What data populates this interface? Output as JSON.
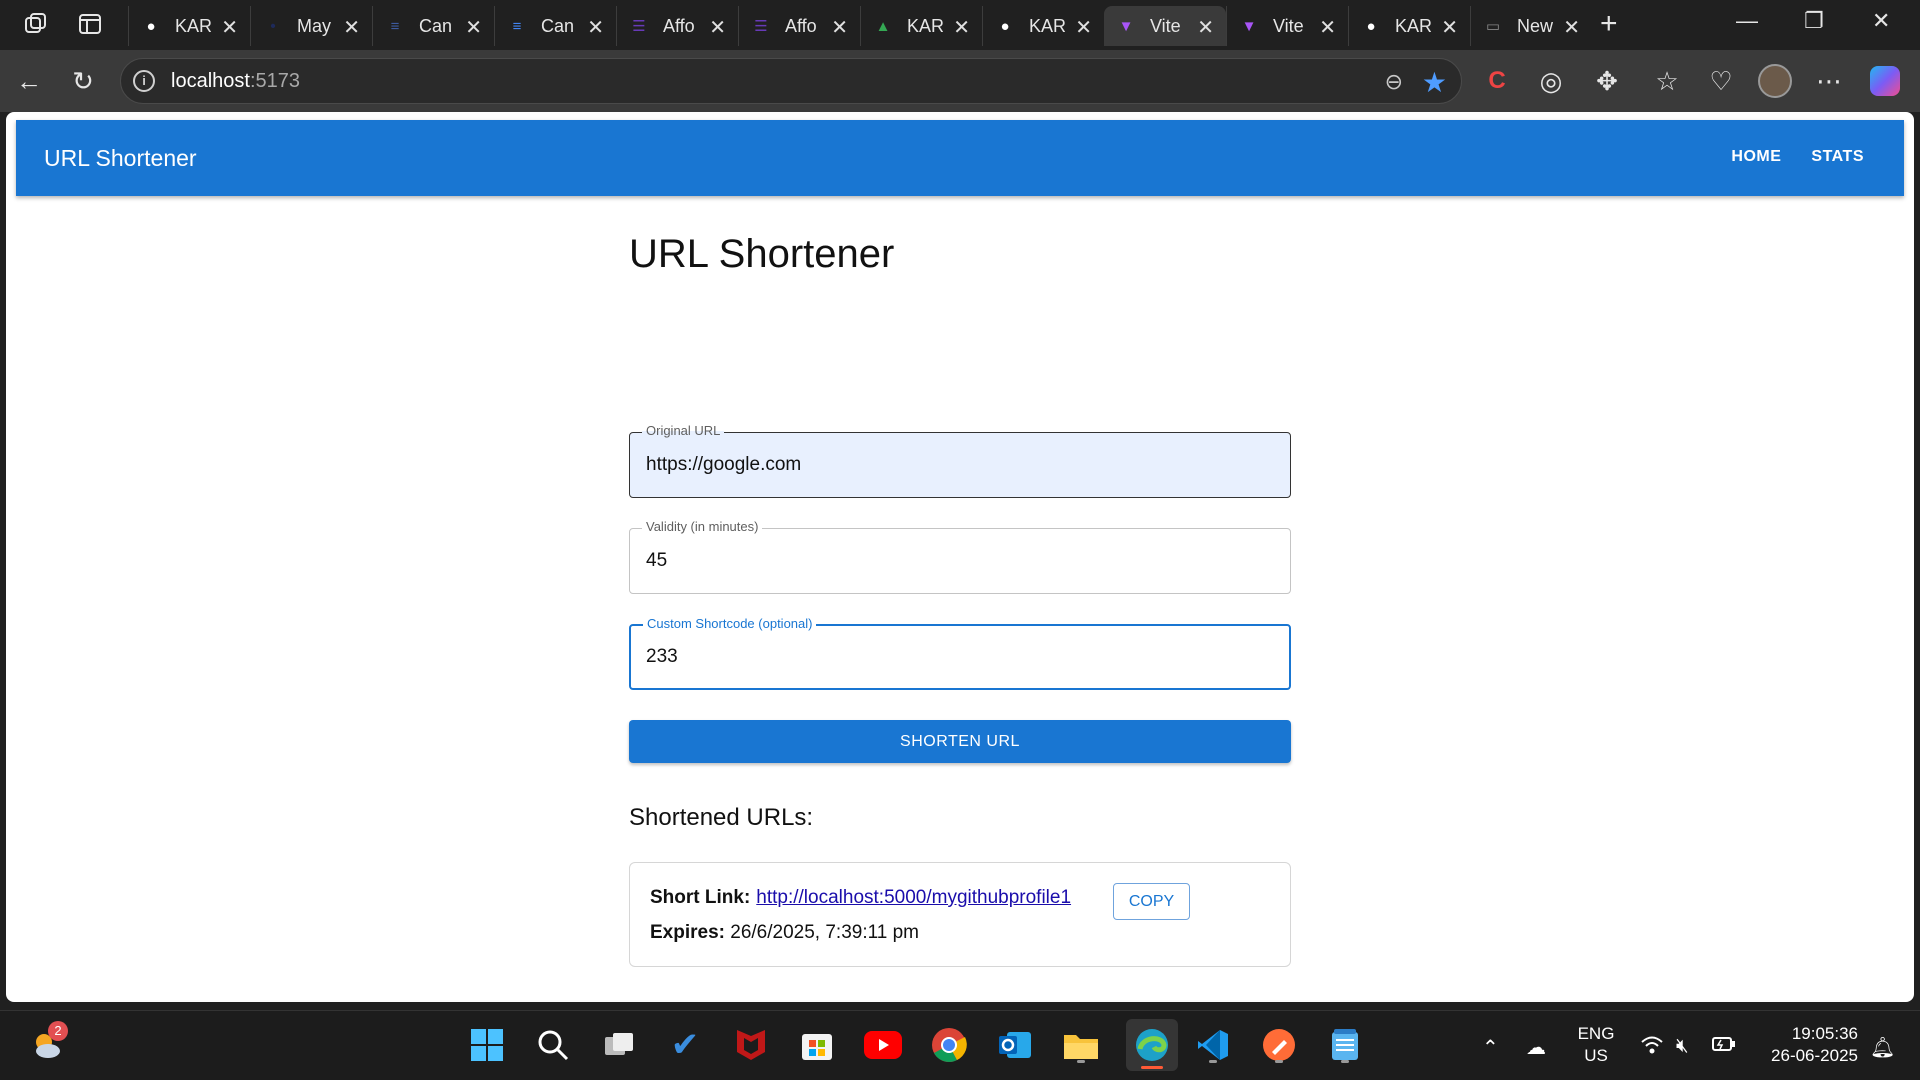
{
  "browser": {
    "tabs": [
      {
        "title": "KAR",
        "icon": "github-icon",
        "color": "#ffffff"
      },
      {
        "title": "May",
        "icon": "dot-icon",
        "color": "#1e2a5a"
      },
      {
        "title": "Can",
        "icon": "doc-icon",
        "color": "#3d5a9e"
      },
      {
        "title": "Can",
        "icon": "doc-icon",
        "color": "#4285f4"
      },
      {
        "title": "Affo",
        "icon": "form-icon",
        "color": "#673ab7"
      },
      {
        "title": "Affo",
        "icon": "form-icon",
        "color": "#673ab7"
      },
      {
        "title": "KAR",
        "icon": "drive-icon",
        "color": "#34a853"
      },
      {
        "title": "KAR",
        "icon": "github-icon",
        "color": "#ffffff"
      },
      {
        "title": "Vite",
        "icon": "vite-icon",
        "color": "#a855f7",
        "active": true
      },
      {
        "title": "Vite",
        "icon": "vite-icon",
        "color": "#a855f7"
      },
      {
        "title": "KAR",
        "icon": "github-icon",
        "color": "#ffffff"
      },
      {
        "title": "New",
        "icon": "newtab-icon",
        "color": "#888888"
      }
    ],
    "address": {
      "host": "localhost",
      "port": ":5173"
    }
  },
  "app": {
    "brand": "URL Shortener",
    "nav": {
      "home": "HOME",
      "stats": "STATS"
    },
    "heading": "URL Shortener",
    "fields": {
      "original_url": {
        "label": "Original URL",
        "value": "https://google.com"
      },
      "validity": {
        "label": "Validity (in minutes)",
        "value": "45"
      },
      "shortcode": {
        "label": "Custom Shortcode (optional)",
        "value": "233"
      }
    },
    "submit_label": "SHORTEN URL",
    "results_heading": "Shortened URLs:",
    "result": {
      "short_link_label": "Short Link:",
      "short_link": "http://localhost:5000/mygithubprofile1",
      "copy_label": "COPY",
      "expires_label": "Expires:",
      "expires_value": "26/6/2025, 7:39:11 pm"
    },
    "colors": {
      "primary": "#1976d2",
      "link": "#1a0dab"
    }
  },
  "taskbar": {
    "weather_badge": "2",
    "lang_line1": "ENG",
    "lang_line2": "US",
    "time": "19:05:36",
    "date": "26-06-2025"
  }
}
